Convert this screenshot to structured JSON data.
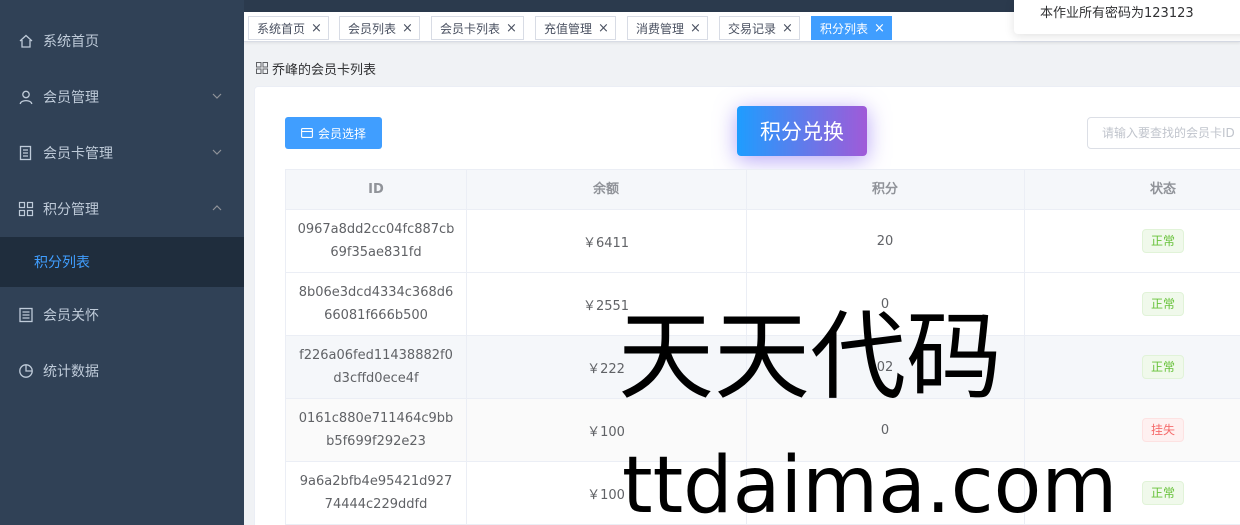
{
  "sidebar": {
    "items": [
      {
        "label": "系统首页",
        "icon": "home-icon"
      },
      {
        "label": "会员管理",
        "icon": "user-icon",
        "expandable": true
      },
      {
        "label": "会员卡管理",
        "icon": "document-icon",
        "expandable": true
      },
      {
        "label": "积分管理",
        "icon": "grid-icon",
        "expandable": true,
        "expanded": true
      },
      {
        "label": "会员关怀",
        "icon": "list-icon"
      },
      {
        "label": "统计数据",
        "icon": "pie-chart-icon"
      }
    ],
    "submenu": {
      "label": "积分列表",
      "active": true
    }
  },
  "tags": [
    {
      "label": "系统首页",
      "active": false
    },
    {
      "label": "会员列表",
      "active": false
    },
    {
      "label": "会员卡列表",
      "active": false
    },
    {
      "label": "充值管理",
      "active": false
    },
    {
      "label": "消费管理",
      "active": false
    },
    {
      "label": "交易记录",
      "active": false
    },
    {
      "label": "积分列表",
      "active": true
    }
  ],
  "tag_close": "×",
  "notice": "本作业所有密码为123123",
  "breadcrumb": "乔峰的会员卡列表",
  "toolbar": {
    "member_select": "会员选择",
    "exchange": "积分兑换",
    "search_placeholder": "请输入要查找的会员卡ID"
  },
  "table": {
    "headers": [
      "ID",
      "余额",
      "积分",
      "状态"
    ],
    "rows": [
      {
        "id": "0967a8dd2cc04fc887cb69f35ae831fd",
        "balance": "￥6411",
        "points": "20",
        "status": "正常",
        "status_type": "ok"
      },
      {
        "id": "8b06e3dcd4334c368d666081f666b500",
        "balance": "￥2551",
        "points": "0",
        "status": "正常",
        "status_type": "ok"
      },
      {
        "id": "f226a06fed11438882f0d3cffd0ece4f",
        "balance": "￥222",
        "points": "02",
        "status": "正常",
        "status_type": "ok"
      },
      {
        "id": "0161c880e711464c9bbb5f699f292e23",
        "balance": "￥100",
        "points": "0",
        "status": "挂失",
        "status_type": "lost"
      },
      {
        "id": "9a6a2bfb4e95421d92774444c229ddfd",
        "balance": "￥100",
        "points": "",
        "status": "正常",
        "status_type": "ok"
      }
    ]
  },
  "watermark": {
    "cn": "天天代码",
    "en": "ttdaima.com"
  },
  "colors": {
    "sidebar_bg": "#304156",
    "primary": "#409eff",
    "active_text": "#409eff",
    "success": "#67c23a",
    "danger": "#f56c6c"
  }
}
